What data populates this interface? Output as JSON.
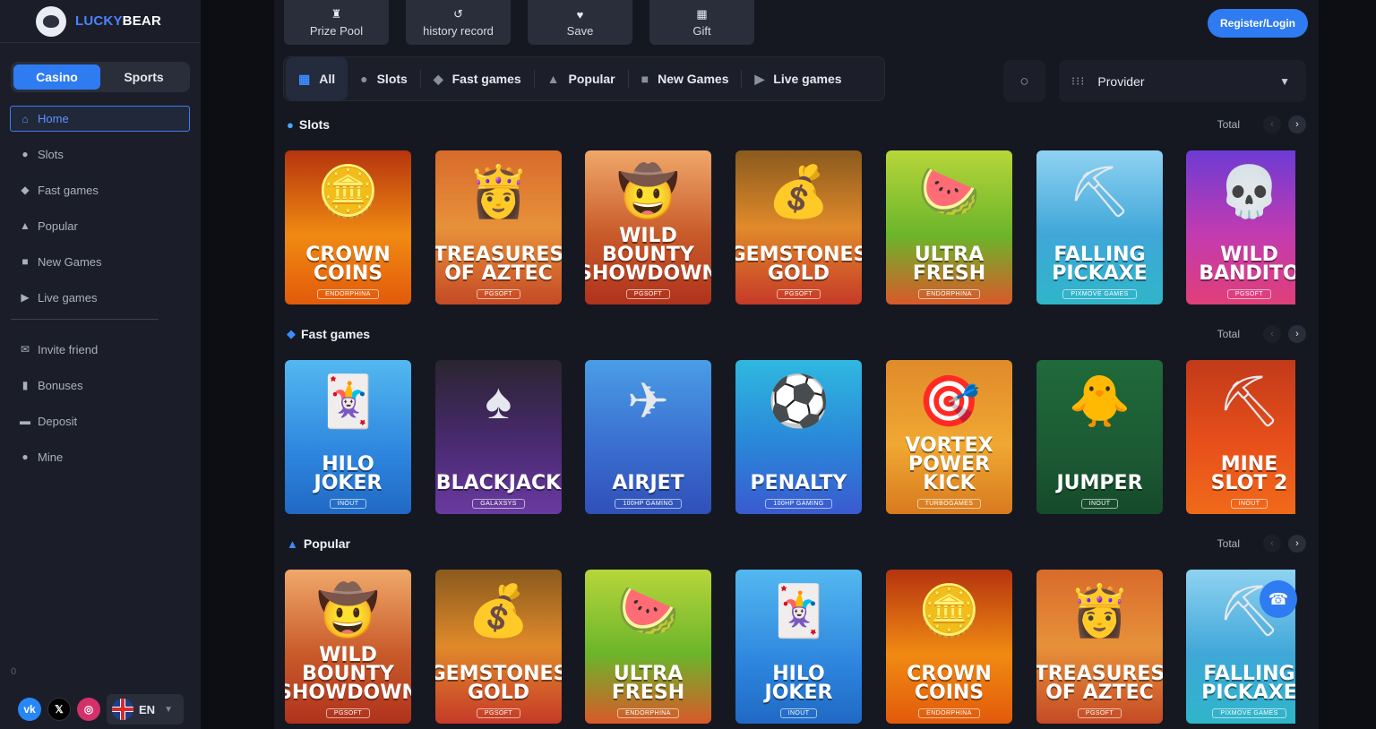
{
  "brand": {
    "lucky": "LUCKY",
    "bear": "BEAR"
  },
  "sidebar": {
    "segments": [
      "Casino",
      "Sports"
    ],
    "nav": [
      {
        "label": "Home",
        "icon": "home-icon",
        "glyph": "⌂"
      },
      {
        "label": "Slots",
        "icon": "cherries-icon",
        "glyph": "●"
      },
      {
        "label": "Fast games",
        "icon": "diamond-icon",
        "glyph": "◆"
      },
      {
        "label": "Popular",
        "icon": "flame-icon",
        "glyph": "▲"
      },
      {
        "label": "New Games",
        "icon": "new-badge-icon",
        "glyph": "■"
      },
      {
        "label": "Live games",
        "icon": "live-play-icon",
        "glyph": "▶"
      }
    ],
    "nav2": [
      {
        "label": "Invite friend",
        "icon": "invite-icon",
        "glyph": "✉"
      },
      {
        "label": "Bonuses",
        "icon": "bookmark-icon",
        "glyph": "▮"
      },
      {
        "label": "Deposit",
        "icon": "wallet-icon",
        "glyph": "▬"
      },
      {
        "label": "Mine",
        "icon": "user-icon",
        "glyph": "●"
      }
    ],
    "counter": "0",
    "language": "EN"
  },
  "topbar": {
    "buttons": [
      {
        "label": "Prize Pool",
        "icon": "trophy-icon",
        "glyph": "♜"
      },
      {
        "label": "history record",
        "icon": "history-icon",
        "glyph": "↺"
      },
      {
        "label": "Save",
        "icon": "heart-icon",
        "glyph": "♥"
      },
      {
        "label": "Gift",
        "icon": "gift-icon",
        "glyph": "▦"
      }
    ],
    "register_label": "Register/Login"
  },
  "categories": [
    {
      "label": "All",
      "icon": "grid-icon",
      "glyph": "▦"
    },
    {
      "label": "Slots",
      "icon": "cherries-icon",
      "glyph": "●"
    },
    {
      "label": "Fast games",
      "icon": "diamond-icon",
      "glyph": "◆"
    },
    {
      "label": "Popular",
      "icon": "flame-icon",
      "glyph": "▲"
    },
    {
      "label": "New Games",
      "icon": "new-badge-icon",
      "glyph": "■"
    },
    {
      "label": "Live games",
      "icon": "live-play-icon",
      "glyph": "▶"
    }
  ],
  "provider": {
    "label": "Provider"
  },
  "total_label": "Total",
  "sections": [
    {
      "title": "Slots",
      "icon": "cherries-icon",
      "glyph": "●",
      "icon_color": "#4aa8ff",
      "games": [
        {
          "name": "CROWN\nCOINS",
          "provider": "ENDORPHINA",
          "bg": "linear-gradient(180deg,#b5340f,#f08a12 55%,#e25a0b)",
          "art": "🪙"
        },
        {
          "name": "TREASURES\nOF AZTEC",
          "provider": "PGSOFT",
          "bg": "linear-gradient(180deg,#d86b2b,#e7913a 50%,#c54a25)",
          "art": "👸"
        },
        {
          "name": "WILD BOUNTY\nSHOWDOWN",
          "provider": "PGSOFT",
          "bg": "linear-gradient(180deg,#f0a86a,#c85a2a 55%,#b0321c)",
          "art": "🤠"
        },
        {
          "name": "GEMSTONES\nGOLD",
          "provider": "PGSOFT",
          "bg": "linear-gradient(180deg,#8a5a1e,#e08a2a 50%,#c63a28)",
          "art": "💰"
        },
        {
          "name": "ULTRA\nFRESH",
          "provider": "ENDORPHINA",
          "bg": "linear-gradient(180deg,#b7d63a,#6bb52a 55%,#d9592a)",
          "art": "🍉"
        },
        {
          "name": "FALLING\nPICKAXE",
          "provider": "PIXMOVE GAMES",
          "bg": "linear-gradient(180deg,#8fd2f2,#3fa7d8 55%,#2fb5c9)",
          "art": "⛏"
        },
        {
          "name": "WILD\nBANDITO",
          "provider": "PGSOFT",
          "bg": "linear-gradient(180deg,#6d3bd3,#c33bb0 55%,#e03f78)",
          "art": "💀"
        }
      ]
    },
    {
      "title": "Fast games",
      "icon": "diamond-icon",
      "glyph": "◆",
      "icon_color": "#3d8cff",
      "games": [
        {
          "name": "HILO\nJOKER",
          "provider": "INOUT",
          "bg": "linear-gradient(180deg,#53b8f0,#2e86de 60%,#2069c4)",
          "art": "🃏"
        },
        {
          "name": "BLACKJACK",
          "provider": "GALAXSYS",
          "bg": "linear-gradient(180deg,#2a2530,#4a2a72 55%,#6a3aa0)",
          "art": "♠"
        },
        {
          "name": "AIRJET",
          "provider": "100HP GAMING",
          "bg": "linear-gradient(180deg,#4a9de6,#3a6fd0 55%,#3050b8)",
          "art": "✈"
        },
        {
          "name": "PENALTY",
          "provider": "100HP GAMING",
          "bg": "linear-gradient(180deg,#2fb8e0,#2a86d8 55%,#3a5ad0)",
          "art": "⚽"
        },
        {
          "name": "VORTEX\nPOWER KICK",
          "provider": "TURBOGAMES",
          "bg": "linear-gradient(180deg,#e08a2a,#f0a832 55%,#d87a1f)",
          "art": "🎯"
        },
        {
          "name": "JUMPER",
          "provider": "INOUT",
          "bg": "linear-gradient(180deg,#1f6a3a,#1c5a34 60%,#154a2a)",
          "art": "🐥"
        },
        {
          "name": "MINE\nSLOT 2",
          "provider": "INOUT",
          "bg": "linear-gradient(180deg,#c23a1a,#e8501a 55%,#f06a1a)",
          "art": "⛏"
        }
      ]
    },
    {
      "title": "Popular",
      "icon": "flame-icon",
      "glyph": "▲",
      "icon_color": "#3d8cff",
      "games": [
        {
          "name": "WILD BOUNTY\nSHOWDOWN",
          "provider": "PGSOFT",
          "bg": "linear-gradient(180deg,#f0a86a,#c85a2a 55%,#b0321c)",
          "art": "🤠"
        },
        {
          "name": "GEMSTONES\nGOLD",
          "provider": "PGSOFT",
          "bg": "linear-gradient(180deg,#8a5a1e,#e08a2a 50%,#c63a28)",
          "art": "💰"
        },
        {
          "name": "ULTRA\nFRESH",
          "provider": "ENDORPHINA",
          "bg": "linear-gradient(180deg,#b7d63a,#6bb52a 55%,#d9592a)",
          "art": "🍉"
        },
        {
          "name": "HILO\nJOKER",
          "provider": "INOUT",
          "bg": "linear-gradient(180deg,#53b8f0,#2e86de 60%,#2069c4)",
          "art": "🃏"
        },
        {
          "name": "CROWN\nCOINS",
          "provider": "ENDORPHINA",
          "bg": "linear-gradient(180deg,#b5340f,#f08a12 55%,#e25a0b)",
          "art": "🪙"
        },
        {
          "name": "TREASURES\nOF AZTEC",
          "provider": "PGSOFT",
          "bg": "linear-gradient(180deg,#d86b2b,#e7913a 50%,#c54a25)",
          "art": "👸"
        },
        {
          "name": "FALLING\nPICKAXE",
          "provider": "PIXMOVE GAMES",
          "bg": "linear-gradient(180deg,#8fd2f2,#3fa7d8 55%,#2fb5c9)",
          "art": "⛏"
        }
      ]
    }
  ]
}
